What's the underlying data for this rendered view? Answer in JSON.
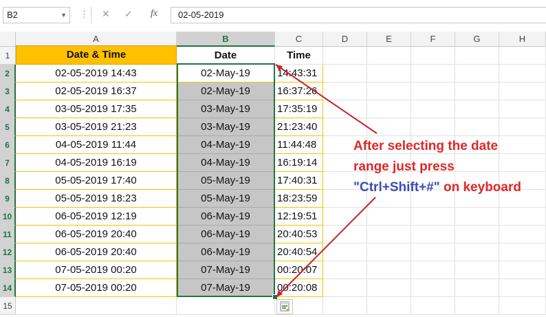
{
  "formula_bar": {
    "name_box": "B2",
    "fx_label": "fx",
    "formula": "02-05-2019"
  },
  "columns": [
    "A",
    "B",
    "C",
    "D",
    "E",
    "F",
    "G",
    "H"
  ],
  "rows": [
    "1",
    "2",
    "3",
    "4",
    "5",
    "6",
    "7",
    "8",
    "9",
    "10",
    "11",
    "12",
    "13",
    "14",
    "15"
  ],
  "headers": {
    "a": "Date & Time",
    "b": "Date",
    "c": "Time"
  },
  "data": [
    {
      "a": "02-05-2019 14:43",
      "b": "02-May-19",
      "c": "14:43:31"
    },
    {
      "a": "02-05-2019 16:37",
      "b": "02-May-19",
      "c": "16:37:26"
    },
    {
      "a": "03-05-2019 17:35",
      "b": "03-May-19",
      "c": "17:35:19"
    },
    {
      "a": "03-05-2019 21:23",
      "b": "03-May-19",
      "c": "21:23:40"
    },
    {
      "a": "04-05-2019 11:44",
      "b": "04-May-19",
      "c": "11:44:48"
    },
    {
      "a": "04-05-2019 16:19",
      "b": "04-May-19",
      "c": "16:19:14"
    },
    {
      "a": "05-05-2019 17:40",
      "b": "05-May-19",
      "c": "17:40:31"
    },
    {
      "a": "05-05-2019 18:23",
      "b": "05-May-19",
      "c": "18:23:59"
    },
    {
      "a": "06-05-2019 12:19",
      "b": "06-May-19",
      "c": "12:19:51"
    },
    {
      "a": "06-05-2019 20:40",
      "b": "06-May-19",
      "c": "20:40:53"
    },
    {
      "a": "06-05-2019 20:40",
      "b": "06-May-19",
      "c": "20:40:54"
    },
    {
      "a": "07-05-2019 00:20",
      "b": "07-May-19",
      "c": "00:20:07"
    },
    {
      "a": "07-05-2019 00:20",
      "b": "07-May-19",
      "c": "00:20:08"
    }
  ],
  "annotation": {
    "line1": "After selecting the date",
    "line2": "range just press",
    "line3_key": "\"Ctrl+Shift+#\"",
    "line3_rest": " on keyboard"
  },
  "colors": {
    "header_fill": "#ffc000",
    "selection": "#217346",
    "annotation_text": "#e02626",
    "annotation_key": "#3c4bb5",
    "arrow": "#c8202a"
  },
  "icons": [
    "cancel-icon",
    "enter-icon",
    "function-icon",
    "quick-analysis-icon",
    "dropdown-arrow-icon"
  ]
}
